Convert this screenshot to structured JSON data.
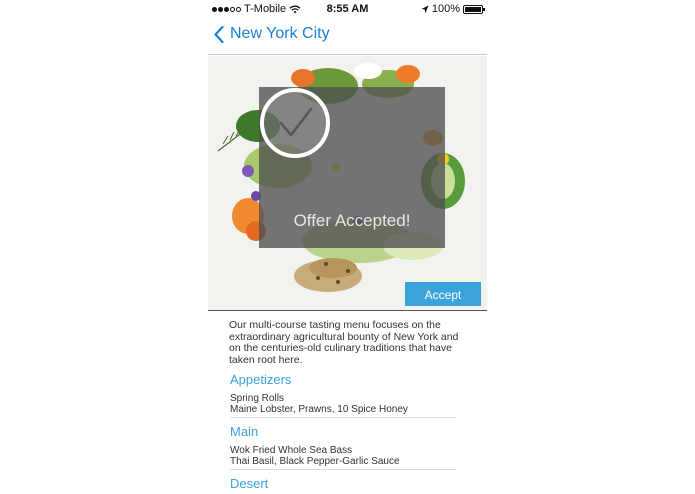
{
  "status_bar": {
    "carrier": "T-Mobile",
    "time": "8:55 AM",
    "battery": "100%",
    "battery_level": 1.0
  },
  "nav": {
    "back_label": "New York City"
  },
  "hero": {
    "overlay_text": "Offer Accepted!",
    "accept_label": "Accept"
  },
  "description": "Our multi-course tasting menu focuses on the extraordinary agricultural bounty of New York and on the centuries-old culinary traditions that have taken root here.",
  "sections": [
    {
      "title": "Appetizers",
      "item_name": "Spring Rolls",
      "item_detail": "Maine Lobster, Prawns, 10 Spice Honey"
    },
    {
      "title": "Main",
      "item_name": "Wok Fried Whole Sea Bass",
      "item_detail": "Thai Basil, Black Pepper-Garlic Sauce"
    },
    {
      "title": "Desert"
    }
  ],
  "colors": {
    "accent": "#3aa3dc",
    "nav_link": "#1a7fd6",
    "overlay": "#505050"
  }
}
